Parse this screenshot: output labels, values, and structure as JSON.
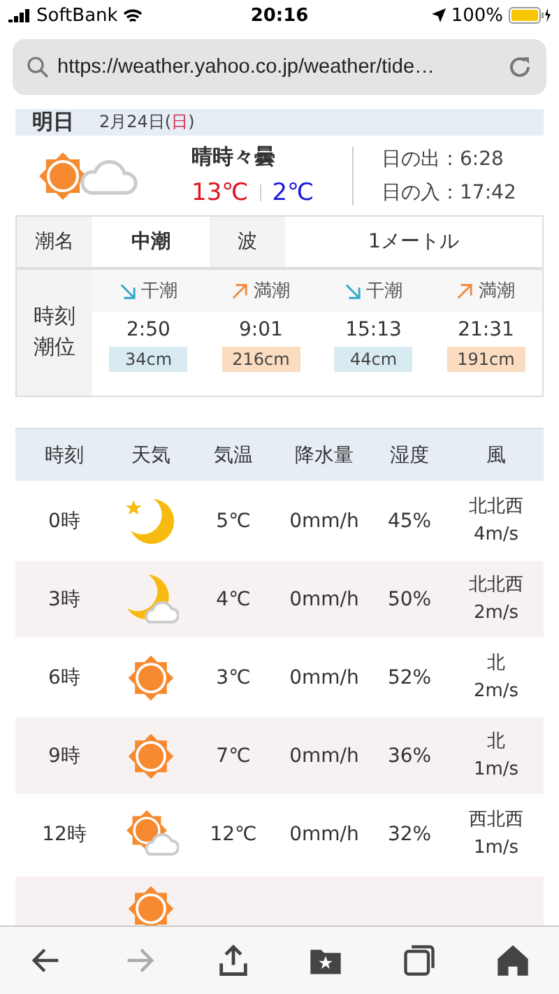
{
  "status_bar": {
    "carrier": "SoftBank",
    "time": "20:16",
    "battery": "100%"
  },
  "address_bar": {
    "url": "https://weather.yahoo.co.jp/weather/tide…"
  },
  "day_header": {
    "label": "明日",
    "date_parts": [
      {
        "text": "2月24日(",
        "kind": "plain"
      },
      {
        "text": "日",
        "kind": "holiday"
      },
      {
        "text": ")",
        "kind": "plain"
      }
    ]
  },
  "summary": {
    "weather": "晴時々曇",
    "kind": "sun_cloud",
    "high": "13℃",
    "low": "2℃",
    "sunrise": "日の出：6:28",
    "sunset": "日の入：17:42"
  },
  "tide": {
    "name_label": "潮名",
    "name": "中潮",
    "wave_label": "波",
    "wave": "1メートル",
    "time_label": [
      "時刻",
      "潮位"
    ],
    "events": [
      {
        "kind": "low",
        "label": "干潮",
        "time": "2:50",
        "height": "34cm"
      },
      {
        "kind": "high",
        "label": "満潮",
        "time": "9:01",
        "height": "216cm"
      },
      {
        "kind": "low",
        "label": "干潮",
        "time": "15:13",
        "height": "44cm"
      },
      {
        "kind": "high",
        "label": "満潮",
        "time": "21:31",
        "height": "191cm"
      }
    ]
  },
  "hourly": {
    "columns": [
      "時刻",
      "天気",
      "気温",
      "降水量",
      "湿度",
      "風"
    ],
    "rows": [
      {
        "time": "0時",
        "kind": "moon",
        "temp": "5℃",
        "precip": "0mm/h",
        "humidity": "45%",
        "wind_dir": "北北西",
        "wind_speed": "4m/s"
      },
      {
        "time": "3時",
        "kind": "moon_cloud",
        "temp": "4℃",
        "precip": "0mm/h",
        "humidity": "50%",
        "wind_dir": "北北西",
        "wind_speed": "2m/s"
      },
      {
        "time": "6時",
        "kind": "sun",
        "temp": "3℃",
        "precip": "0mm/h",
        "humidity": "52%",
        "wind_dir": "北",
        "wind_speed": "2m/s"
      },
      {
        "time": "9時",
        "kind": "sun",
        "temp": "7℃",
        "precip": "0mm/h",
        "humidity": "36%",
        "wind_dir": "北",
        "wind_speed": "1m/s"
      },
      {
        "time": "12時",
        "kind": "sun_cloud",
        "temp": "12℃",
        "precip": "0mm/h",
        "humidity": "32%",
        "wind_dir": "西北西",
        "wind_speed": "1m/s"
      }
    ],
    "partial_row": {
      "kind": "sun"
    }
  },
  "toolbar": [
    {
      "kind": "back",
      "disabled": false
    },
    {
      "kind": "forward",
      "disabled": true
    },
    {
      "kind": "share",
      "disabled": false
    },
    {
      "kind": "bookmarks",
      "disabled": false
    },
    {
      "kind": "tabs",
      "disabled": false
    },
    {
      "kind": "home",
      "disabled": false
    }
  ]
}
